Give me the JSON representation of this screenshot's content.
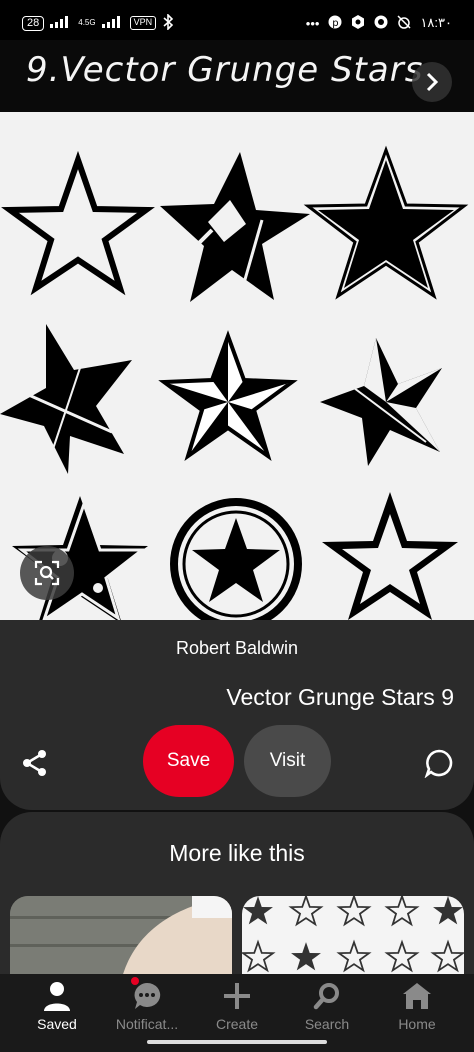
{
  "status_bar": {
    "battery": "28",
    "network_type": "4.5G",
    "vpn": "VPN",
    "time": "۱۸:۳۰"
  },
  "pin": {
    "banner_text": "9.Vector Grunge Stars",
    "creator": "Robert Baldwin",
    "title": "Vector Grunge Stars 9",
    "save_label": "Save",
    "visit_label": "Visit"
  },
  "more": {
    "title": "More like this"
  },
  "nav": {
    "items": [
      {
        "label": "Saved",
        "icon": "person-icon",
        "active": true
      },
      {
        "label": "Notificat...",
        "icon": "chat-bubbles-icon",
        "active": false
      },
      {
        "label": "Create",
        "icon": "plus-icon",
        "active": false
      },
      {
        "label": "Search",
        "icon": "search-icon",
        "active": false
      },
      {
        "label": "Home",
        "icon": "home-icon",
        "active": false
      }
    ]
  },
  "colors": {
    "accent": "#e60023",
    "card": "#2b2b2b",
    "nav": "#1a1a1a"
  }
}
